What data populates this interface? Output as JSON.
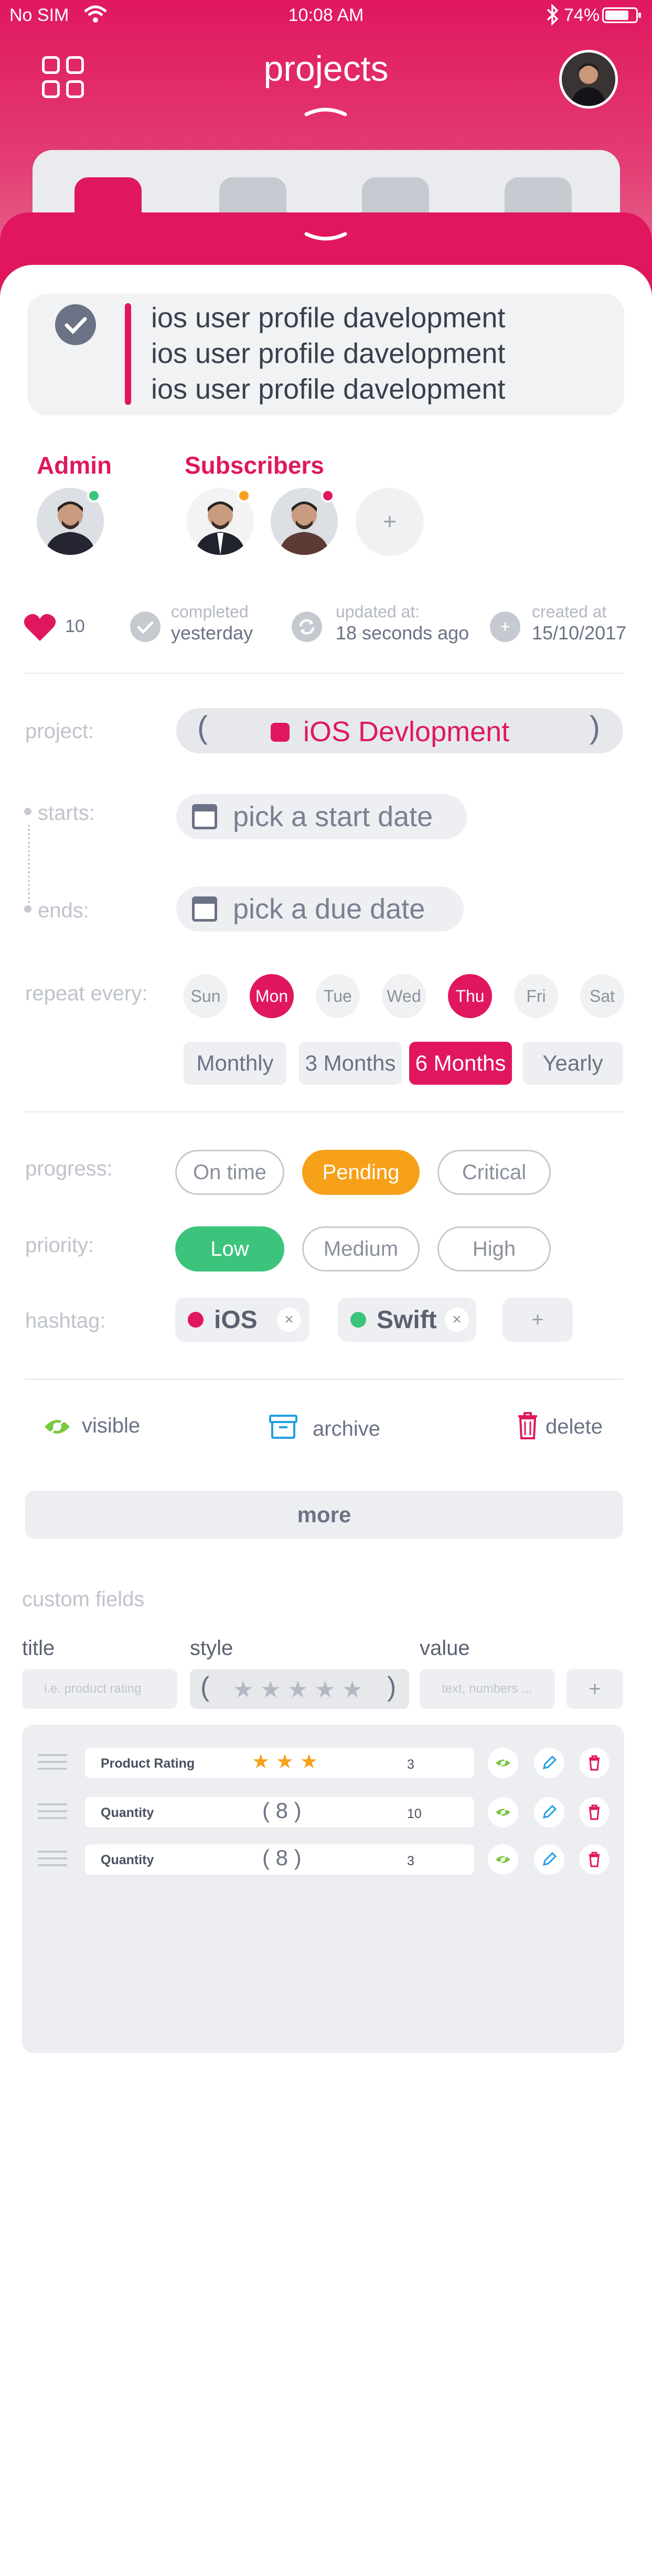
{
  "status_bar": {
    "carrier": "No SIM",
    "time": "10:08 AM",
    "battery": "74%"
  },
  "header": {
    "title": "projects"
  },
  "task": {
    "lines": [
      "ios user profile davelopment",
      "ios user profile davelopment",
      "ios user profile davelopment"
    ]
  },
  "people": {
    "admin_label": "Admin",
    "subscribers_label": "Subscribers",
    "add_symbol": "+"
  },
  "stats": {
    "likes": "10",
    "completed_label": "completed",
    "completed_value": "yesterday",
    "updated_label": "updated at:",
    "updated_value": "18 seconds ago",
    "created_label": "created at",
    "created_value": "15/10/2017"
  },
  "project": {
    "label": "project:",
    "value": "iOS Devlopment",
    "left_paren": "(",
    "right_paren": ")"
  },
  "dates": {
    "starts_label": "starts:",
    "starts_placeholder": "pick a start date",
    "ends_label": "ends:",
    "ends_placeholder": "pick a due date"
  },
  "repeat": {
    "label": "repeat every:",
    "days": [
      "Sun",
      "Mon",
      "Tue",
      "Wed",
      "Thu",
      "Fri",
      "Sat"
    ],
    "selected_days": [
      "Mon",
      "Thu"
    ],
    "frequencies": [
      "Monthly",
      "3 Months",
      "6 Months",
      "Yearly"
    ],
    "selected_frequency": "6 Months"
  },
  "progress": {
    "label": "progress:",
    "options": [
      "On time",
      "Pending",
      "Critical"
    ],
    "selected": "Pending"
  },
  "priority": {
    "label": "priority:",
    "options": [
      "Low",
      "Medium",
      "High"
    ],
    "selected": "Low"
  },
  "hashtag": {
    "label": "hashtag:",
    "tags": [
      {
        "name": "iOS",
        "color": "#e0175f"
      },
      {
        "name": "Swift",
        "color": "#3cc47c"
      }
    ],
    "remove_symbol": "×",
    "add_symbol": "+"
  },
  "actions": {
    "visible": "visible",
    "archive": "archive",
    "delete": "delete",
    "more": "more"
  },
  "custom_fields": {
    "title": "custom fields",
    "columns": {
      "title": "title",
      "style": "style",
      "value": "value"
    },
    "title_placeholder": "i.e. product rating",
    "value_placeholder": "text, numbers ...",
    "add_symbol": "+",
    "style_stars": 5,
    "rows": [
      {
        "name": "Product Rating",
        "kind": "stars",
        "stars": 3,
        "value": "3"
      },
      {
        "name": "Quantity",
        "kind": "stepper",
        "stepper": "8",
        "value": "10"
      },
      {
        "name": "Quantity",
        "kind": "stepper",
        "stepper": "8",
        "value": "3"
      }
    ]
  },
  "colors": {
    "accent": "#e0175f",
    "pending": "#f7a11a",
    "low": "#3cc47c",
    "visible_icon": "#7ac943",
    "archive_icon": "#1fa0e3",
    "delete_icon": "#e0175f"
  }
}
